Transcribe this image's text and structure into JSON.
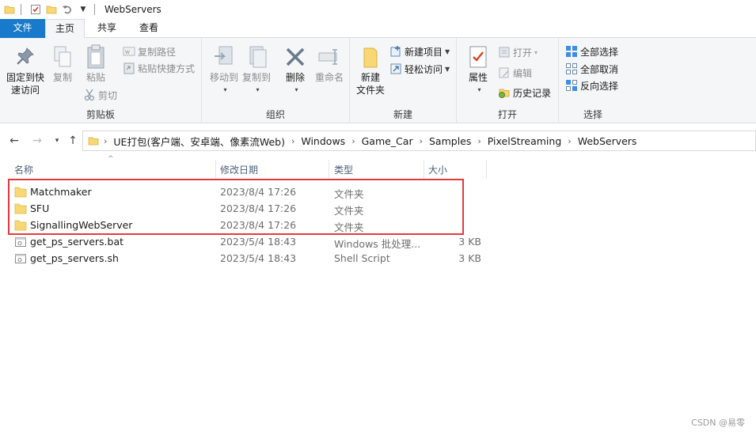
{
  "window": {
    "title": "WebServers"
  },
  "tabs": {
    "file": "文件",
    "home": "主页",
    "share": "共享",
    "view": "查看"
  },
  "ribbon": {
    "clipboard": {
      "label": "剪贴板",
      "pin": "固定到快\n速访问",
      "pin_l1": "固定到快",
      "pin_l2": "速访问",
      "copy": "复制",
      "paste": "粘贴",
      "copy_path": "复制路径",
      "paste_shortcut": "粘贴快捷方式",
      "cut": "剪切"
    },
    "organize": {
      "label": "组织",
      "move_to": "移动到",
      "copy_to": "复制到",
      "delete": "删除",
      "rename": "重命名"
    },
    "new": {
      "label": "新建",
      "new_folder_l1": "新建",
      "new_folder_l2": "文件夹",
      "new_item": "新建项目",
      "easy_access": "轻松访问"
    },
    "open": {
      "label": "打开",
      "properties": "属性",
      "open": "打开",
      "edit": "编辑",
      "history": "历史记录"
    },
    "select": {
      "label": "选择",
      "select_all": "全部选择",
      "select_none": "全部取消",
      "invert": "反向选择"
    }
  },
  "address": {
    "breadcrumbs": [
      "UE打包(客户端、安卓端、像素流Web)",
      "Windows",
      "Game_Car",
      "Samples",
      "PixelStreaming",
      "WebServers"
    ]
  },
  "columns": {
    "name": "名称",
    "date": "修改日期",
    "type": "类型",
    "size": "大小"
  },
  "files": [
    {
      "name": "Matchmaker",
      "date": "2023/8/4 17:26",
      "type": "文件夹",
      "size": "",
      "kind": "folder"
    },
    {
      "name": "SFU",
      "date": "2023/8/4 17:26",
      "type": "文件夹",
      "size": "",
      "kind": "folder"
    },
    {
      "name": "SignallingWebServer",
      "date": "2023/8/4 17:26",
      "type": "文件夹",
      "size": "",
      "kind": "folder"
    },
    {
      "name": "get_ps_servers.bat",
      "date": "2023/5/4 18:43",
      "type": "Windows 批处理...",
      "size": "3 KB",
      "kind": "file"
    },
    {
      "name": "get_ps_servers.sh",
      "date": "2023/5/4 18:43",
      "type": "Shell Script",
      "size": "3 KB",
      "kind": "file"
    }
  ],
  "watermark": "CSDN @易零",
  "colors": {
    "accent": "#1979ca",
    "highlight": "#e53a3a",
    "folder": "#f8d775"
  }
}
